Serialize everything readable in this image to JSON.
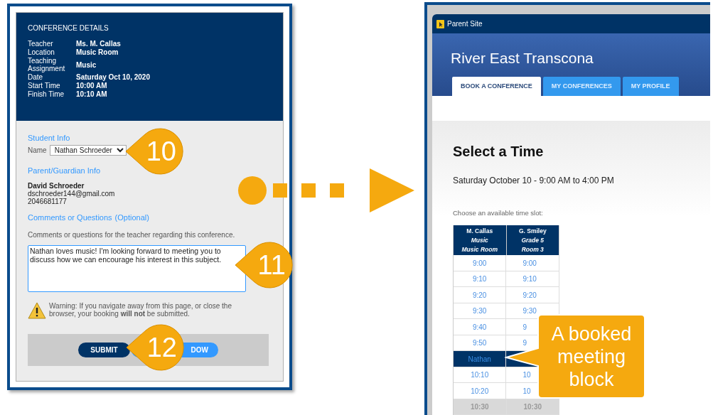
{
  "left_form": {
    "details_title": "CONFERENCE DETAILS",
    "details": [
      {
        "label": "Teacher",
        "value": "Ms. M. Callas"
      },
      {
        "label": "Location",
        "value": "Music Room"
      },
      {
        "label": "Teaching Assignment",
        "value": "Music"
      },
      {
        "label": "Date",
        "value": "Saturday Oct 10, 2020"
      },
      {
        "label": "Start Time",
        "value": "10:00 AM"
      },
      {
        "label": "Finish Time",
        "value": "10:10 AM"
      }
    ],
    "student_heading": "Student Info",
    "name_label": "Name",
    "name_value": "Nathan Schroeder",
    "parent_heading": "Parent/Guardian Info",
    "parent_name": "David Schroeder",
    "parent_email": "dschroeder144@gmail.com",
    "parent_phone": "2046681177",
    "comments_heading": "Comments or Questions",
    "comments_optional": "(Optional)",
    "comments_hint": "Comments or questions for the teacher regarding this conference.",
    "comments_value": "Nathan loves music! I'm looking forward to meeting you to discuss how we can encourage his interest in this subject.",
    "warning": "Warning: If you navigate away from this page, or close the browser, your booking **will not** be submitted.",
    "buttons": [
      {
        "label": "SUBMIT",
        "kind": "primary"
      },
      {
        "label": "DOW",
        "kind": "secondary"
      }
    ]
  },
  "step_callouts": [
    {
      "label": "10"
    },
    {
      "label": "11"
    },
    {
      "label": "12"
    }
  ],
  "right_site": {
    "site_name": "Parent Site",
    "school": "River East Transcona",
    "tabs": [
      {
        "label": "BOOK A CONFERENCE",
        "selected": true
      },
      {
        "label": "MY CONFERENCES",
        "selected": false
      },
      {
        "label": "MY PROFILE",
        "selected": false
      }
    ],
    "heading": "Select a Time",
    "date_range": "Saturday October 10 - 9:00 AM to 4:00 PM",
    "choose_label": "Choose an available time slot:",
    "columns": [
      {
        "name": "M. Callas",
        "subject": "Music",
        "room": "Music Room"
      },
      {
        "name": "G. Smiley",
        "subject": "Grade 5",
        "room": "Room 3"
      }
    ],
    "rows": [
      {
        "kind": "open",
        "cells": [
          "9:00",
          "9:00"
        ]
      },
      {
        "kind": "open",
        "cells": [
          "9:10",
          "9:10"
        ]
      },
      {
        "kind": "open",
        "cells": [
          "9:20",
          "9:20"
        ]
      },
      {
        "kind": "open",
        "cells": [
          "9:30",
          "9:30"
        ]
      },
      {
        "kind": "open",
        "cells": [
          "9:40",
          "9"
        ]
      },
      {
        "kind": "open",
        "cells": [
          "9:50",
          "9"
        ]
      },
      {
        "kind": "booked",
        "cells": [
          "Nathan"
        ]
      },
      {
        "kind": "open",
        "cells": [
          "10:10",
          "10"
        ]
      },
      {
        "kind": "open",
        "cells": [
          "10:20",
          "10"
        ]
      },
      {
        "kind": "unavailable",
        "cells": [
          "10:30",
          "10:30"
        ]
      }
    ]
  },
  "booked_callout": "A booked meeting block"
}
